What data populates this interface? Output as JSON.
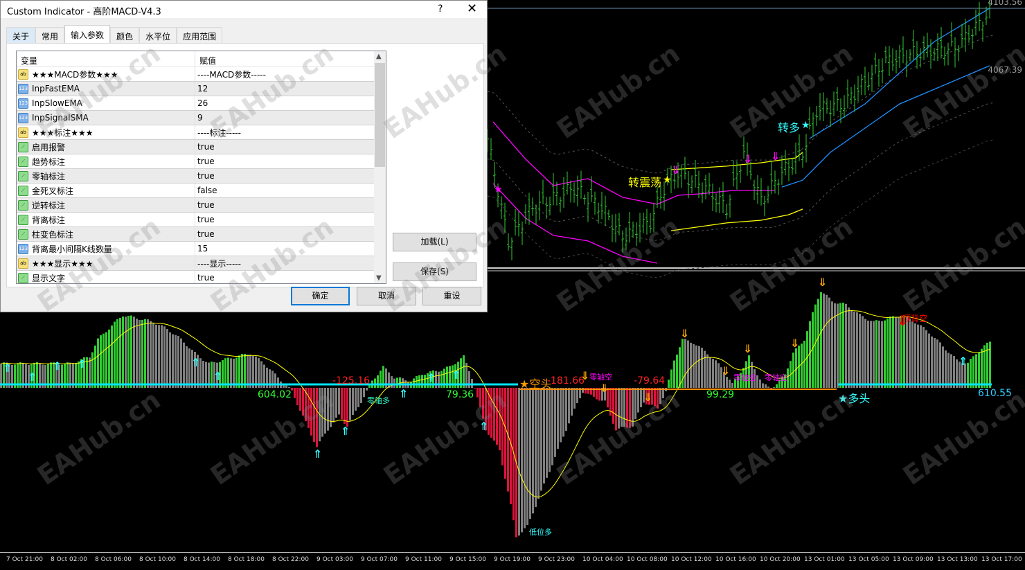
{
  "dialog": {
    "title": "Custom Indicator - 高阶MACD-V4.3",
    "help": "?",
    "close": "✕",
    "tabs": [
      "关于",
      "常用",
      "输入参数",
      "颜色",
      "水平位",
      "应用范围"
    ],
    "active_tab": "输入参数",
    "columns": [
      "变量",
      "赋值"
    ],
    "rows": [
      {
        "icon": "ab",
        "name": "★★★MACD参数★★★",
        "value": "----MACD参数-----"
      },
      {
        "icon": "123",
        "name": "InpFastEMA",
        "value": "12"
      },
      {
        "icon": "123",
        "name": "InpSlowEMA",
        "value": "26"
      },
      {
        "icon": "123",
        "name": "InpSignalSMA",
        "value": "9"
      },
      {
        "icon": "ab",
        "name": "★★★标注★★★",
        "value": "----标注-----"
      },
      {
        "icon": "bool",
        "name": "启用报警",
        "value": "true"
      },
      {
        "icon": "bool",
        "name": "趋势标注",
        "value": "true"
      },
      {
        "icon": "bool",
        "name": "零轴标注",
        "value": "true"
      },
      {
        "icon": "bool",
        "name": "金死叉标注",
        "value": "false"
      },
      {
        "icon": "bool",
        "name": "逆转标注",
        "value": "true"
      },
      {
        "icon": "bool",
        "name": "背离标注",
        "value": "true"
      },
      {
        "icon": "bool",
        "name": "柱变色标注",
        "value": "true"
      },
      {
        "icon": "123",
        "name": "背离最小间隔K线数量",
        "value": "15"
      },
      {
        "icon": "ab",
        "name": "★★★显示★★★",
        "value": "----显示-----"
      },
      {
        "icon": "bool",
        "name": "显示文字",
        "value": "true"
      }
    ],
    "buttons": {
      "load": "加载(L)",
      "save": "保存(S)",
      "ok": "确定",
      "cancel": "取消",
      "reset": "重设"
    }
  },
  "price_labels": {
    "high": "4103.56",
    "level": "4067.39"
  },
  "annotations": {
    "to_range": "转震荡",
    "to_long": "转多",
    "short_head": "★空头",
    "long_head": "★多头",
    "zero_long": "零轴多",
    "zero_short": "零轴空",
    "top_div_short": "顶背空",
    "low_long": "低位多",
    "v1": "604.02",
    "v2": "-125.16",
    "v3": "79.36",
    "v4": "-181.66",
    "v5": "-79.64",
    "v6": "99.29",
    "v7": "610.55"
  },
  "time_axis": [
    "7 Oct 21:00",
    "8 Oct 02:00",
    "8 Oct 06:00",
    "8 Oct 10:00",
    "8 Oct 14:00",
    "8 Oct 18:00",
    "8 Oct 22:00",
    "9 Oct 03:00",
    "9 Oct 07:00",
    "9 Oct 11:00",
    "9 Oct 15:00",
    "9 Oct 19:00",
    "9 Oct 23:00",
    "10 Oct 04:00",
    "10 Oct 08:00",
    "10 Oct 12:00",
    "10 Oct 16:00",
    "10 Oct 20:00",
    "13 Oct 01:00",
    "13 Oct 05:00",
    "13 Oct 09:00",
    "13 Oct 13:00",
    "13 Oct 17:00"
  ],
  "watermark": "EAHub.cn",
  "colors": {
    "up": "#32cd32",
    "gray": "#808080",
    "red": "#dc143c",
    "signal": "#ffff00",
    "zero_long": "#00e5ff",
    "zero_short": "#ff8c00",
    "magenta": "#ff00ff",
    "blue": "#1e90ff",
    "yellow": "#ffff00"
  },
  "chart_data": {
    "type": "line",
    "price": {
      "ylim": [
        3950,
        4108
      ],
      "closes": [
        [
          0,
          4026
        ],
        [
          6,
          3965
        ],
        [
          13,
          3985
        ],
        [
          25,
          3997
        ],
        [
          33,
          3985
        ],
        [
          39,
          3968
        ],
        [
          47,
          3977
        ],
        [
          51,
          3997
        ],
        [
          55,
          4006
        ],
        [
          63,
          3997
        ],
        [
          69,
          3985
        ],
        [
          74,
          4018
        ],
        [
          79,
          3989
        ],
        [
          85,
          4006
        ],
        [
          91,
          4018
        ],
        [
          95,
          4043
        ],
        [
          103,
          4047
        ],
        [
          115,
          4072
        ],
        [
          125,
          4078
        ],
        [
          135,
          4080
        ],
        [
          141,
          4092
        ],
        [
          146,
          4104
        ]
      ],
      "bands": [
        {
          "name": "upper-magenta",
          "color": "magenta",
          "points": [
            [
              1.6,
              4036.2
            ],
            [
              11,
              4014
            ],
            [
              19,
              3998.4
            ],
            [
              29,
              4002.5
            ],
            [
              39,
              3991.4
            ],
            [
              49,
              3987.3
            ],
            [
              55,
              3992.6
            ],
            [
              61,
              3993.4
            ],
            [
              71,
              3995.5
            ],
            [
              79,
              3995.5
            ],
            [
              83,
              3995.5
            ]
          ]
        },
        {
          "name": "upper-blue",
          "color": "blue",
          "points": [
            [
              85,
              3997.5
            ],
            [
              91,
              4001.6
            ],
            [
              99,
              4018.1
            ],
            [
              119,
              4046.8
            ],
            [
              145,
              4069.5
            ]
          ]
        },
        {
          "name": "lower-magenta",
          "color": "magenta",
          "points": [
            [
              1.6,
              3999.6
            ],
            [
              11,
              3979
            ],
            [
              19,
              3968.8
            ],
            [
              29,
              3965.5
            ],
            [
              39,
              3956.4
            ],
            [
              49,
              3952.3
            ]
          ]
        },
        {
          "name": "mid-yellow",
          "color": "yellow",
          "points": [
            [
              53,
              4007.8
            ],
            [
              69,
              4009.9
            ],
            [
              79,
              4011.9
            ],
            [
              89,
              4014.8
            ],
            [
              91,
              4018.1
            ]
          ]
        },
        {
          "name": "mid-blue",
          "color": "blue",
          "points": [
            [
              93,
              4026.3
            ],
            [
              109,
              4046.8
            ],
            [
              129,
              4083.8
            ],
            [
              145,
              4103.6
            ]
          ]
        },
        {
          "name": "lower-yellow",
          "color": "yellow",
          "points": [
            [
              53,
              3971.6
            ],
            [
              69,
              3976.2
            ],
            [
              79,
              3977.8
            ],
            [
              87,
              3981.1
            ],
            [
              91,
              3984.4
            ]
          ]
        }
      ]
    },
    "macd": {
      "ylim": [
        -900,
        600
      ],
      "bars": 358,
      "points": [
        [
          0,
          140
        ],
        [
          25,
          140
        ],
        [
          32,
          180
        ],
        [
          35,
          280
        ],
        [
          40,
          360
        ],
        [
          44,
          420
        ],
        [
          50,
          400
        ],
        [
          55,
          380
        ],
        [
          60,
          340
        ],
        [
          65,
          280
        ],
        [
          70,
          200
        ],
        [
          75,
          140
        ],
        [
          80,
          160
        ],
        [
          85,
          180
        ],
        [
          90,
          200
        ],
        [
          95,
          140
        ],
        [
          100,
          60
        ],
        [
          105,
          -20
        ],
        [
          110,
          -200
        ],
        [
          114,
          -340
        ],
        [
          118,
          -240
        ],
        [
          122,
          -160
        ],
        [
          125,
          -220
        ],
        [
          130,
          -80
        ],
        [
          134,
          40
        ],
        [
          138,
          120
        ],
        [
          142,
          60
        ],
        [
          148,
          40
        ],
        [
          152,
          80
        ],
        [
          158,
          100
        ],
        [
          162,
          120
        ],
        [
          167,
          180
        ],
        [
          170,
          60
        ],
        [
          173,
          -120
        ],
        [
          175,
          -240
        ],
        [
          180,
          -360
        ],
        [
          184,
          -680
        ],
        [
          186,
          -860
        ],
        [
          190,
          -800
        ],
        [
          195,
          -600
        ],
        [
          200,
          -400
        ],
        [
          205,
          -200
        ],
        [
          210,
          -20
        ],
        [
          212,
          -40
        ],
        [
          218,
          -80
        ],
        [
          222,
          -240
        ],
        [
          228,
          -220
        ],
        [
          232,
          -80
        ],
        [
          237,
          -120
        ],
        [
          240,
          -20
        ],
        [
          243,
          160
        ],
        [
          246,
          280
        ],
        [
          250,
          260
        ],
        [
          255,
          200
        ],
        [
          260,
          120
        ],
        [
          264,
          20
        ],
        [
          268,
          120
        ],
        [
          270,
          180
        ],
        [
          273,
          80
        ],
        [
          275,
          20
        ],
        [
          278,
          0
        ],
        [
          280,
          20
        ],
        [
          283,
          80
        ],
        [
          286,
          200
        ],
        [
          290,
          280
        ],
        [
          294,
          480
        ],
        [
          296,
          560
        ],
        [
          300,
          500
        ],
        [
          305,
          480
        ],
        [
          310,
          420
        ],
        [
          315,
          380
        ],
        [
          320,
          400
        ],
        [
          325,
          420
        ],
        [
          330,
          380
        ],
        [
          335,
          320
        ],
        [
          340,
          240
        ],
        [
          345,
          160
        ],
        [
          349,
          140
        ],
        [
          352,
          200
        ],
        [
          358,
          280
        ]
      ]
    }
  }
}
